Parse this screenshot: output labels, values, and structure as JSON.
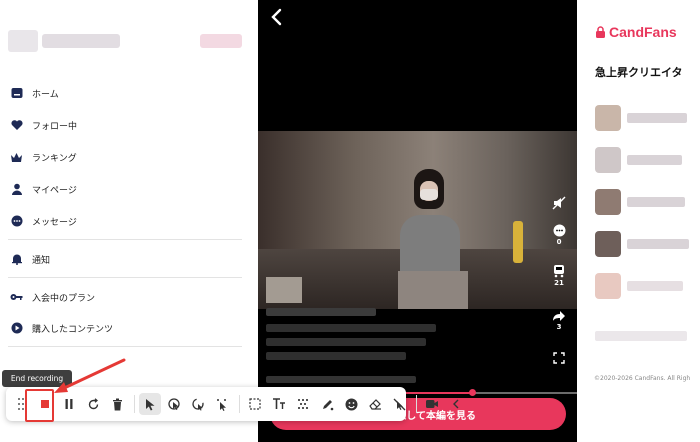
{
  "sidebar": {
    "items": [
      {
        "label": "ホーム",
        "icon": "home-icon"
      },
      {
        "label": "フォロー中",
        "icon": "heart-icon"
      },
      {
        "label": "ランキング",
        "icon": "crown-icon"
      },
      {
        "label": "マイページ",
        "icon": "user-icon"
      },
      {
        "label": "メッセージ",
        "icon": "chat-icon"
      },
      {
        "label": "通知",
        "icon": "bell-icon"
      },
      {
        "label": "入会中のプラン",
        "icon": "key-icon"
      },
      {
        "label": "購入したコンテンツ",
        "icon": "play-icon"
      }
    ]
  },
  "video": {
    "counts": {
      "comments": "0",
      "purchases": "21",
      "shares": "3"
    },
    "progress": 0.67,
    "cta_label": "入して本編を見る"
  },
  "right": {
    "brand": "CandFans",
    "section_title": "急上昇クリエイタ",
    "copyright": "©2020-2026 CandFans. All Righ"
  },
  "toolbar": {
    "tooltip": "End recording",
    "icons": [
      "drag-handle-icon",
      "stop-record-icon",
      "pause-icon",
      "restart-icon",
      "trash-icon",
      "cursor-icon",
      "click-highlight-icon",
      "spotlight-icon",
      "magic-cursor-icon",
      "select-area-icon",
      "text-icon",
      "blur-icon",
      "pen-icon",
      "emoji-icon",
      "eraser-icon",
      "hide-clicks-icon",
      "camera-icon",
      "collapse-icon"
    ]
  },
  "colors": {
    "accent": "#e8375c",
    "highlight": "#e53935"
  }
}
